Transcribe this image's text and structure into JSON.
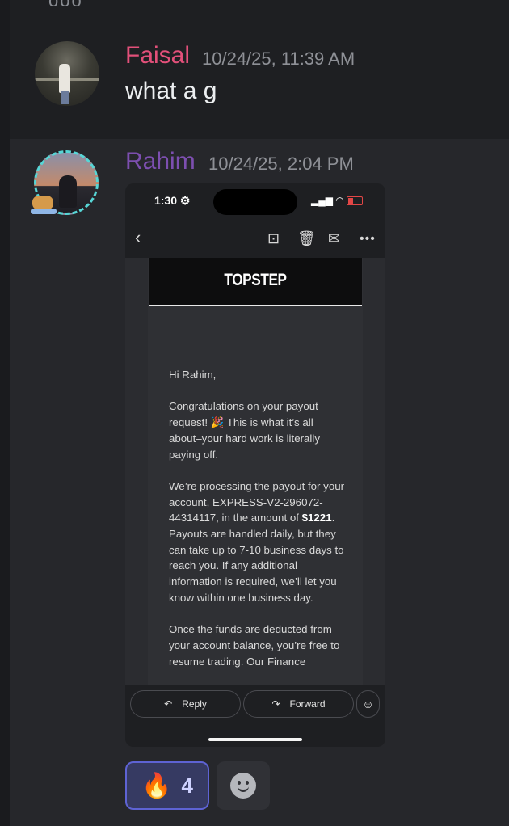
{
  "previous_fragment": "ooo",
  "messages": [
    {
      "author": "Faisal",
      "author_color": "#e3507a",
      "timestamp": "10/24/25, 11:39 AM",
      "text": "what a g"
    },
    {
      "author": "Rahim",
      "author_color": "#7d4fb0",
      "timestamp": "10/24/25, 2:04 PM",
      "attachment": {
        "status_time": "1:30",
        "status_gear": "⚙",
        "status_icons": "▂▄▆ ◠",
        "toolbar": {
          "back": "‹",
          "archive": "⊡",
          "trash": "🗑",
          "mail": "✉",
          "more": "•••"
        },
        "email": {
          "logo": "TOPSTEP",
          "greeting": "Hi Rahim,",
          "p1": "Congratulations on your payout request! 🎉 This is what it’s all about–your hard work is literally paying off.",
          "p2_before": "We’re processing the payout for your account, EXPRESS-V2-296072-44314117, in the amount of ",
          "p2_amount": "$1221",
          "p2_after": ". Payouts are handled daily, but they can take up to 7-10 business days to reach you. If any additional information is required, we’ll let you know within one business day.",
          "p3": "Once the funds are deducted from your account balance, you’re free to resume trading. Our Finance"
        },
        "actions": {
          "reply": "Reply",
          "reply_icon": "↶",
          "forward": "Forward",
          "forward_icon": "↷",
          "emoji": "☺"
        }
      },
      "reactions": [
        {
          "emoji": "🔥",
          "count": "4",
          "active": true
        }
      ]
    }
  ],
  "colors": {
    "background": "#1e1f22",
    "highlight_row": "#26272b",
    "reaction_border": "#5e63d4"
  }
}
